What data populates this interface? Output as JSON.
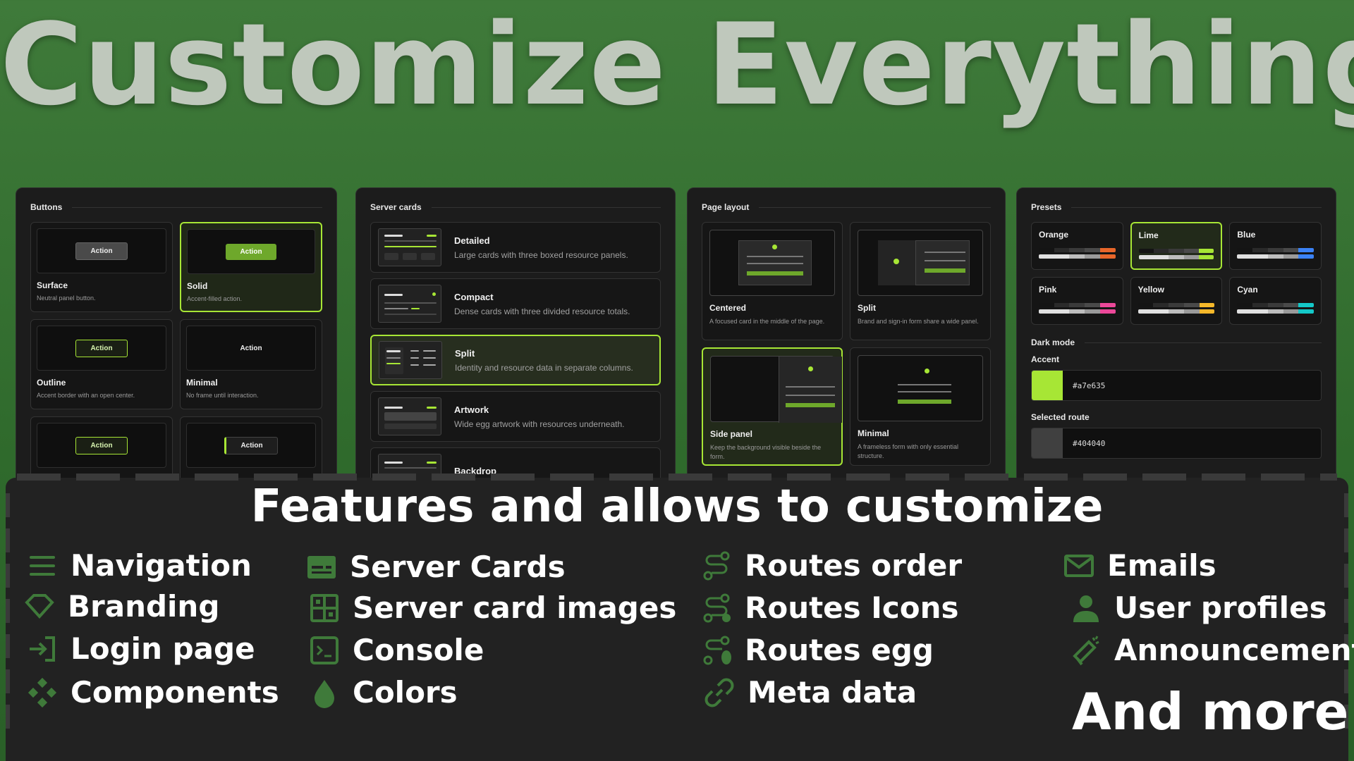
{
  "hero_title": "Customize Everything",
  "buttons_panel": {
    "title": "Buttons",
    "tiles": [
      {
        "action": "Action",
        "title": "Surface",
        "desc": "Neutral panel button."
      },
      {
        "action": "Action",
        "title": "Solid",
        "desc": "Accent-filled action."
      },
      {
        "action": "Action",
        "title": "Outline",
        "desc": "Accent border with an open center."
      },
      {
        "action": "Action",
        "title": "Minimal",
        "desc": "No frame until interaction."
      },
      {
        "action": "Action"
      },
      {
        "action": "Action"
      }
    ]
  },
  "cards_panel": {
    "title": "Server cards",
    "items": [
      {
        "title": "Detailed",
        "desc": "Large cards with three boxed resource panels."
      },
      {
        "title": "Compact",
        "desc": "Dense cards with three divided resource totals."
      },
      {
        "title": "Split",
        "desc": "Identity and resource data in separate columns."
      },
      {
        "title": "Artwork",
        "desc": "Wide egg artwork with resources underneath."
      },
      {
        "title": "Backdrop"
      }
    ]
  },
  "layout_panel": {
    "title": "Page layout",
    "tiles": [
      {
        "title": "Centered",
        "desc": "A focused card in the middle of the page."
      },
      {
        "title": "Split",
        "desc": "Brand and sign-in form share a wide panel."
      },
      {
        "title": "Side panel",
        "desc": "Keep the background visible beside the form."
      },
      {
        "title": "Minimal",
        "desc": "A frameless form with only essential structure."
      }
    ]
  },
  "presets_panel": {
    "title": "Presets",
    "presets": [
      {
        "name": "Orange",
        "color": "#e8662a"
      },
      {
        "name": "Lime",
        "color": "#a7e635"
      },
      {
        "name": "Blue",
        "color": "#3b82f6"
      },
      {
        "name": "Pink",
        "color": "#ec4899"
      },
      {
        "name": "Yellow",
        "color": "#f5b82a"
      },
      {
        "name": "Cyan",
        "color": "#14c8c8"
      }
    ],
    "dark_mode_label": "Dark mode",
    "accent_label": "Accent",
    "accent_value": "#a7e635",
    "route_label": "Selected route",
    "route_value": "#404040"
  },
  "features": {
    "title": "Features and allows to customize",
    "items": [
      {
        "label": "Navigation",
        "icon": "menu-icon"
      },
      {
        "label": "Branding",
        "icon": "diamond-icon"
      },
      {
        "label": "Login page",
        "icon": "login-icon"
      },
      {
        "label": "Components",
        "icon": "components-icon"
      },
      {
        "label": "Server Cards",
        "icon": "card-icon"
      },
      {
        "label": "Server card images",
        "icon": "image-grid-icon"
      },
      {
        "label": "Console",
        "icon": "terminal-icon"
      },
      {
        "label": "Colors",
        "icon": "droplet-icon"
      },
      {
        "label": "Routes order",
        "icon": "route-icon"
      },
      {
        "label": "Routes Icons",
        "icon": "route-icons-icon"
      },
      {
        "label": "Routes egg",
        "icon": "route-egg-icon"
      },
      {
        "label": "Meta data",
        "icon": "link-icon"
      },
      {
        "label": "Emails",
        "icon": "mail-icon"
      },
      {
        "label": "User profiles",
        "icon": "user-icon"
      },
      {
        "label": "Announcements",
        "icon": "megaphone-icon"
      }
    ],
    "more": "And more!"
  },
  "colors": {
    "accent": "#a7e635",
    "icon_green": "#3f7a3a",
    "panel": "#1c1c1c"
  }
}
